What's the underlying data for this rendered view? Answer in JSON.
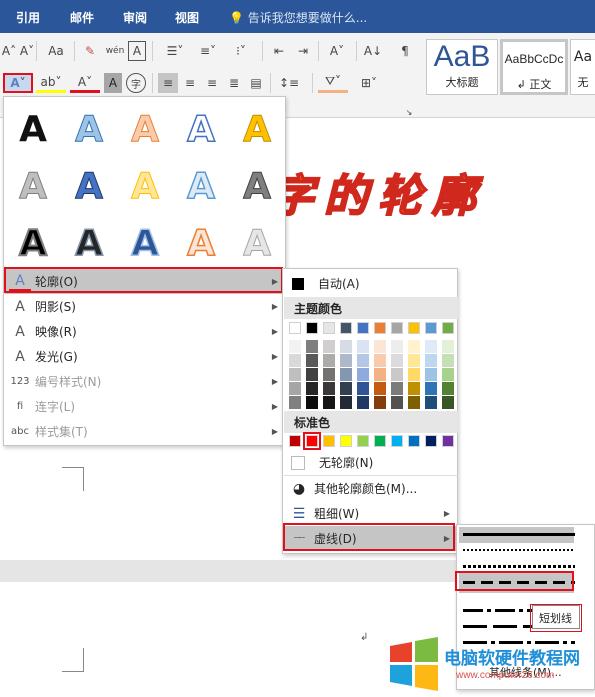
{
  "tabs": [
    "引用",
    "邮件",
    "审阅",
    "视图"
  ],
  "tell_me": "告诉我您想要做什么...",
  "styles": [
    {
      "preview": "AaB",
      "name": "大标题"
    },
    {
      "preview": "AaBbCcDc",
      "name": "↲ 正文"
    },
    {
      "preview": "Aa",
      "name": "无"
    }
  ],
  "ribbon_glyphs": {
    "text_effects": "A",
    "font_size_down": "A˅",
    "change_case": "Aa",
    "clear_format": "✎",
    "phonetic": "wén",
    "char_border": "A",
    "char_shading": "A",
    "enclosed": "字",
    "highlight": "ab",
    "font_color": "A",
    "sort": "A↓",
    "para_mark": "¶"
  },
  "wordart": {
    "text": "字的轮廓",
    "fill": "#f5c400",
    "outline": "#d0281c"
  },
  "gallery_letter": "A",
  "menu": [
    {
      "label": "轮廓(O)",
      "icon": "A",
      "enabled": true,
      "submenu": true
    },
    {
      "label": "阴影(S)",
      "icon": "A",
      "enabled": true,
      "submenu": true
    },
    {
      "label": "映像(R)",
      "icon": "A",
      "enabled": true,
      "submenu": true
    },
    {
      "label": "发光(G)",
      "icon": "A",
      "enabled": true,
      "submenu": true
    },
    {
      "label": "编号样式(N)",
      "icon": "123",
      "enabled": false,
      "submenu": true
    },
    {
      "label": "连字(L)",
      "icon": "fi",
      "enabled": false,
      "submenu": true
    },
    {
      "label": "样式集(T)",
      "icon": "abc",
      "enabled": false,
      "submenu": true
    }
  ],
  "color_panel": {
    "auto": "自动(A)",
    "theme_header": "主题颜色",
    "standard_header": "标准色",
    "no_outline": "无轮廓(N)",
    "more_colors": "其他轮廓颜色(M)...",
    "weight": "粗细(W)",
    "dashes": "虚线(D)"
  },
  "theme_colors": [
    "#ffffff",
    "#000000",
    "#e7e6e6",
    "#44546a",
    "#4472c4",
    "#ed7d31",
    "#a5a5a5",
    "#ffc000",
    "#5b9bd5",
    "#70ad47"
  ],
  "theme_shades": [
    [
      "#f2f2f2",
      "#d9d9d9",
      "#bfbfbf",
      "#a6a6a6",
      "#808080"
    ],
    [
      "#7f7f7f",
      "#595959",
      "#404040",
      "#262626",
      "#0d0d0d"
    ],
    [
      "#d0cece",
      "#aeaaaa",
      "#757171",
      "#3a3838",
      "#171616"
    ],
    [
      "#d6dce5",
      "#adb9ca",
      "#8497b0",
      "#333f50",
      "#222a35"
    ],
    [
      "#dae3f3",
      "#b4c7e7",
      "#8faadc",
      "#2f5597",
      "#203864"
    ],
    [
      "#fbe5d6",
      "#f8cbad",
      "#f4b183",
      "#c55a11",
      "#843c0c"
    ],
    [
      "#ededed",
      "#dbdbdb",
      "#c9c9c9",
      "#7b7b7b",
      "#525252"
    ],
    [
      "#fff2cc",
      "#ffe699",
      "#ffd966",
      "#bf9000",
      "#7f6000"
    ],
    [
      "#deebf7",
      "#bdd7ee",
      "#9dc3e6",
      "#2e75b6",
      "#1f4e79"
    ],
    [
      "#e2f0d9",
      "#c5e0b4",
      "#a9d18e",
      "#548235",
      "#385723"
    ]
  ],
  "standard_colors": [
    "#c00000",
    "#ff0000",
    "#ffc000",
    "#ffff00",
    "#92d050",
    "#00b050",
    "#00b0f0",
    "#0070c0",
    "#002060",
    "#7030a0"
  ],
  "dash_menu": {
    "more_lines": "其他线条(M)...",
    "tooltip": "短划线"
  },
  "watermark": {
    "title": "电脑软硬件教程网",
    "url": "www.computer26.com"
  }
}
